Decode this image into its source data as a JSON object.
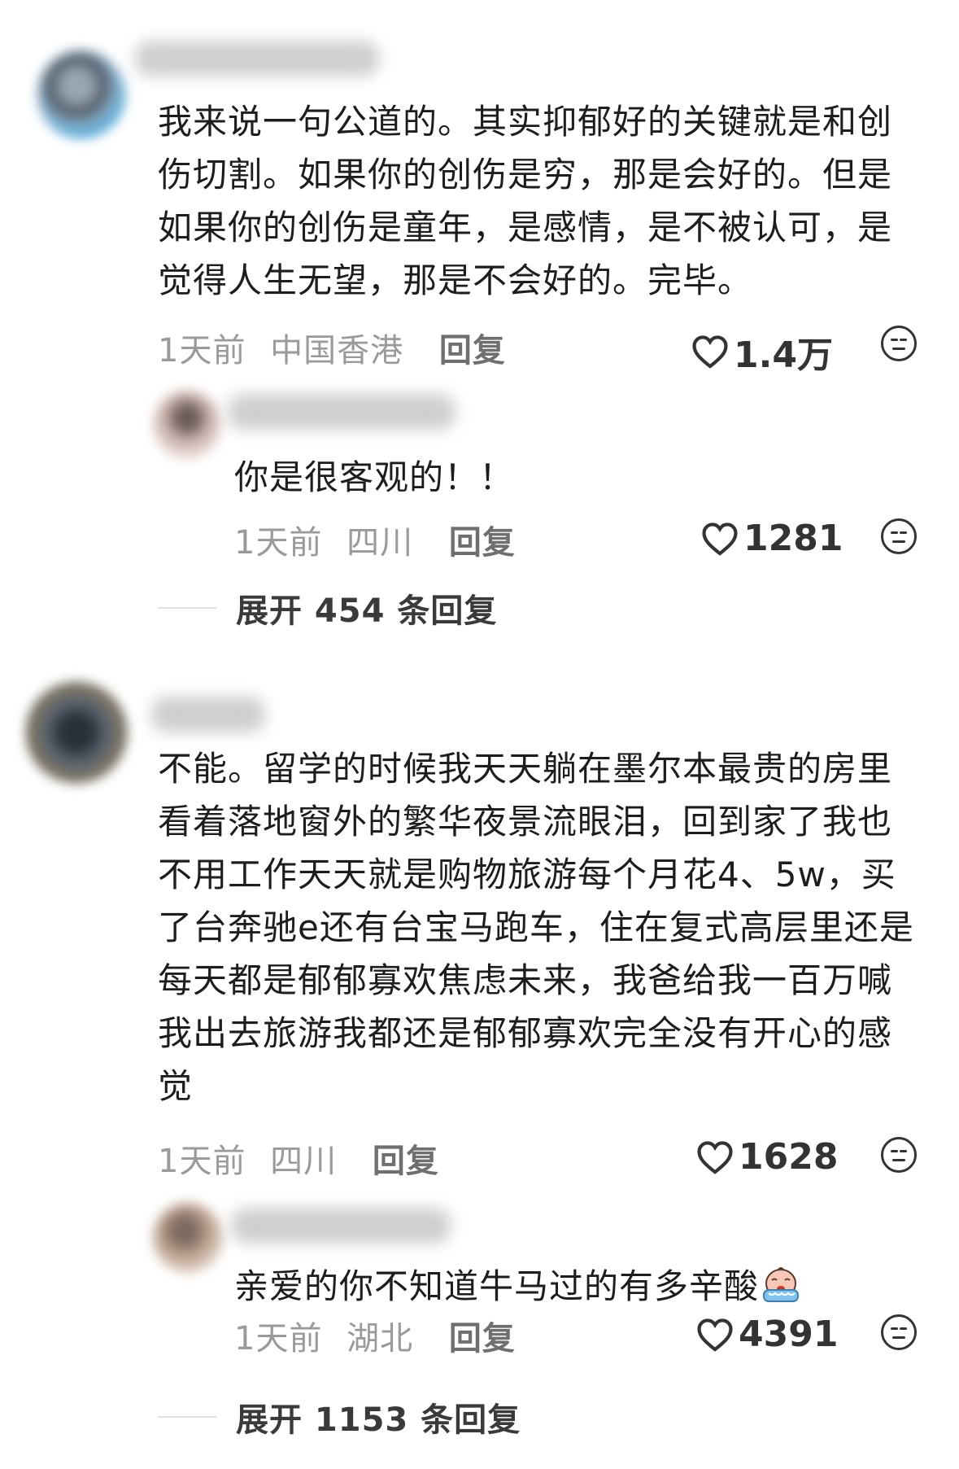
{
  "comments": [
    {
      "text": "我来说一句公道的。其实抑郁好的关键就是和创伤切割。如果你的创伤是穷，那是会好的。但是如果你的创伤是童年，是感情，是不被认可，是觉得人生无望，那是不会好的。完毕。",
      "time": "1天前",
      "location": "中国香港",
      "reply_label": "回复",
      "likes": "1.4万",
      "replies": [
        {
          "text": "你是很客观的！！",
          "time": "1天前",
          "location": "四川",
          "reply_label": "回复",
          "likes": "1281"
        }
      ],
      "expand_label": "展开 454 条回复"
    },
    {
      "text": "不能。留学的时候我天天躺在墨尔本最贵的房里看着落地窗外的繁华夜景流眼泪，回到家了我也不用工作天天就是购物旅游每个月花4、5w，买了台奔驰e还有台宝马跑车，住在复式高层里还是每天都是郁郁寡欢焦虑未来，我爸给我一百万喊我出去旅游我都还是郁郁寡欢完全没有开心的感觉",
      "time": "1天前",
      "location": "四川",
      "reply_label": "回复",
      "likes": "1628",
      "replies": [
        {
          "text": "亲爱的你不知道牛马过的有多辛酸",
          "emoji": "crying-face-emoji",
          "time": "1天前",
          "location": "湖北",
          "reply_label": "回复",
          "likes": "4391"
        }
      ],
      "expand_label": "展开 1153 条回复"
    }
  ],
  "icons": {
    "like": "heart-outline-icon",
    "dislike": "unamused-face-icon"
  },
  "colors": {
    "meta": "#9a9a9a",
    "text": "#1d1d1d"
  }
}
